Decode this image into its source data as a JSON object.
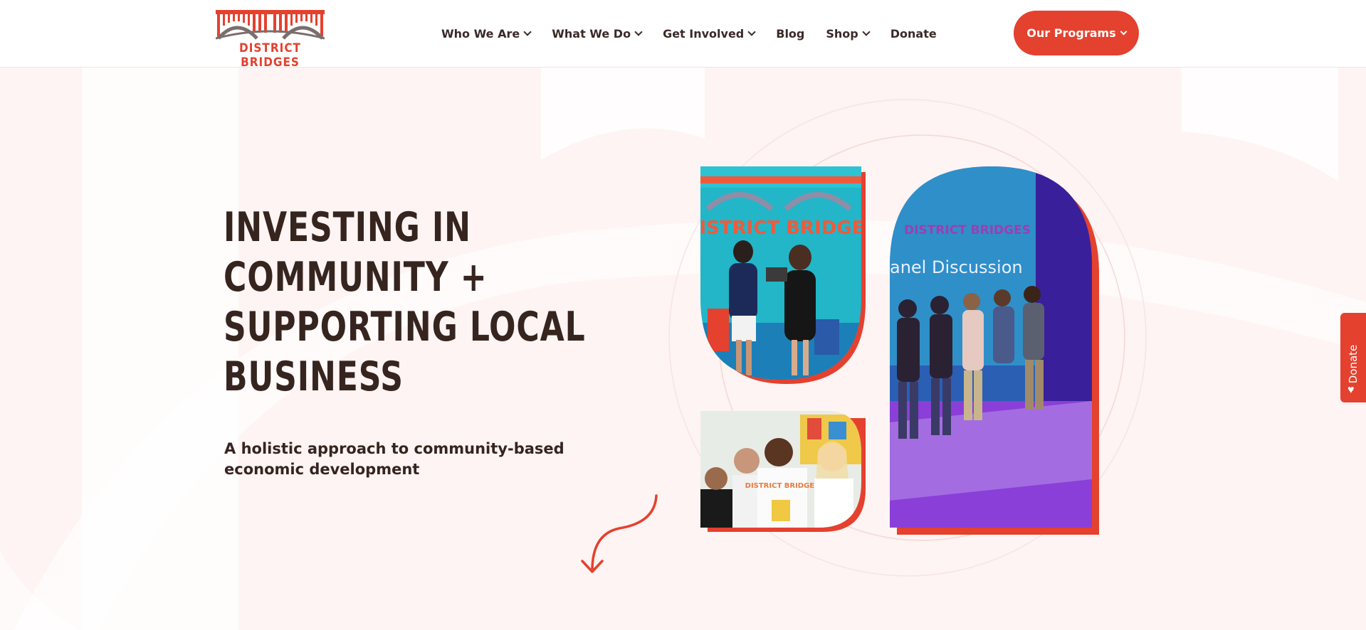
{
  "brand": {
    "name": "DISTRICT BRIDGES",
    "accent": "#e4412f",
    "text_color": "#36241f",
    "hero_bg": "#fdf4f3"
  },
  "nav": {
    "items": [
      {
        "label": "Who We Are",
        "has_dropdown": true
      },
      {
        "label": "What We Do",
        "has_dropdown": true
      },
      {
        "label": "Get Involved",
        "has_dropdown": true
      },
      {
        "label": "Blog",
        "has_dropdown": false
      },
      {
        "label": "Shop",
        "has_dropdown": true
      },
      {
        "label": "Donate",
        "has_dropdown": false
      }
    ],
    "cta_label": "Our Programs"
  },
  "hero": {
    "headline_lines": [
      "Investing in",
      "community +",
      "supporting local",
      "business"
    ],
    "subheading": "A holistic approach to community-based economic development"
  },
  "photos": {
    "top_left_banner_text": "DISTRICT BRIDGES",
    "stage_banner_text": "DISTRICT BRIDGES",
    "stage_sign": "anel Discussion",
    "tshirt_text": "DISTRICT BRIDGES"
  },
  "donate_tab": {
    "label": "Donate",
    "icon": "heart-icon"
  }
}
